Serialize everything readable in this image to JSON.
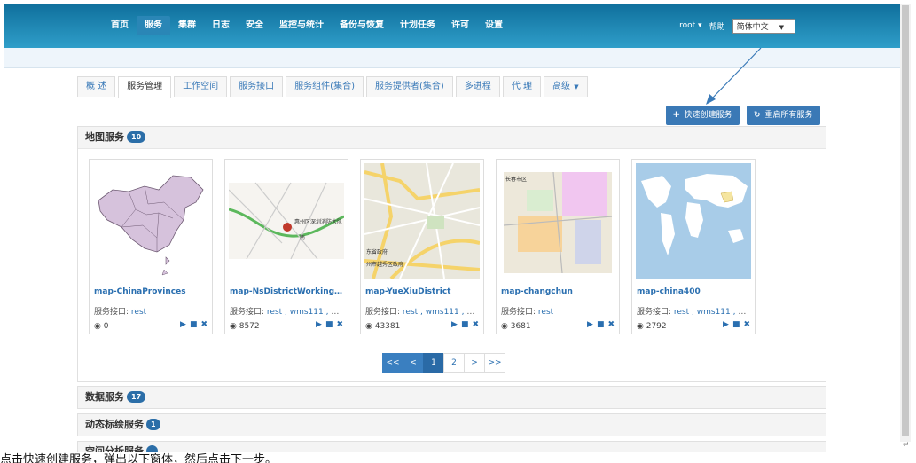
{
  "nav": {
    "items": [
      "首页",
      "服务",
      "集群",
      "日志",
      "安全",
      "监控与统计",
      "备份与恢复",
      "计划任务",
      "许可",
      "设置"
    ],
    "active": "服务",
    "user": "root ▾",
    "help": "帮助",
    "lang": "简体中文"
  },
  "tabs": [
    {
      "label": "概 述"
    },
    {
      "label": "服务管理",
      "active": true
    },
    {
      "label": "工作空间"
    },
    {
      "label": "服务接口"
    },
    {
      "label": "服务组件(集合)"
    },
    {
      "label": "服务提供者(集合)"
    },
    {
      "label": "多进程"
    },
    {
      "label": "代 理"
    },
    {
      "label": "高级",
      "dropdown": true
    }
  ],
  "actions": {
    "quick_create": "快速创建服务",
    "restart_all": "重启所有服务"
  },
  "map_services": {
    "title": "地图服务",
    "count": "10",
    "interface_label": "服务接口:",
    "cards": [
      {
        "title": "map-ChinaProvinces",
        "interfaces": "rest",
        "views": "0"
      },
      {
        "title": "map-NsDistrictWorkingSp...",
        "interfaces": "rest , wms111 , w...",
        "views": "8572"
      },
      {
        "title": "map-YueXiuDistrict",
        "interfaces": "rest , wms111 , w...",
        "views": "43381"
      },
      {
        "title": "map-changchun",
        "interfaces": "rest",
        "views": "3681"
      },
      {
        "title": "map-china400",
        "interfaces": "rest , wms111 , w...",
        "views": "2792"
      }
    ]
  },
  "pagination": [
    "<<",
    "<",
    "1",
    "2",
    ">",
    ">>"
  ],
  "data_services": {
    "title": "数据服务",
    "count": "17"
  },
  "plot_services": {
    "title": "动态标绘服务",
    "count": "1"
  },
  "spatial_services": {
    "title": "空间分析服务"
  },
  "map_labels": {
    "ns_label1": "惠州区深圳消防大队",
    "ns_label2": "南",
    "yx_label1": "东省政府",
    "yx_label2": "州市越秀区政府",
    "cc_label": "长春市区"
  },
  "bottom_text": "点击快速创建服务，弹出以下窗体，然后点击下一步。",
  "colors": {
    "brand": "#1a86b6",
    "link": "#2a6fb0",
    "button": "#3a79b6"
  }
}
